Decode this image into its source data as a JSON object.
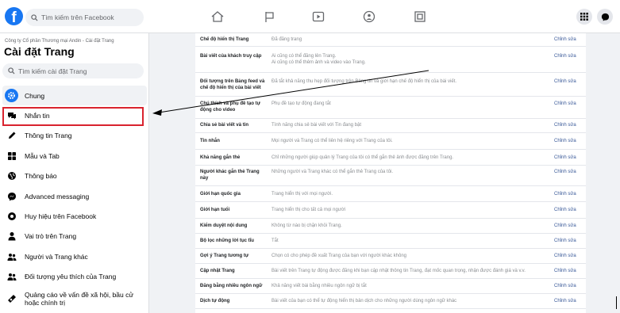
{
  "topbar": {
    "logo": "f",
    "search_placeholder": "Tìm kiếm trên Facebook",
    "nav_icons": [
      "home-icon",
      "flag-icon",
      "video-icon",
      "groups-icon",
      "gaming-icon"
    ],
    "right_icons": [
      "menu-grid-icon",
      "messenger-icon"
    ]
  },
  "sidebar": {
    "company": "Công ty Cổ phần Thương mại Andin - Cài đặt Trang",
    "title": "Cài đặt Trang",
    "search_placeholder": "Tìm kiếm cài đặt Trang",
    "items": [
      {
        "label": "Chung",
        "icon": "gear-icon"
      },
      {
        "label": "Nhắn tin",
        "icon": "chat-bubble-icon"
      },
      {
        "label": "Thông tin Trang",
        "icon": "pencil-icon"
      },
      {
        "label": "Mẫu và Tab",
        "icon": "tabs-grid-icon"
      },
      {
        "label": "Thông báo",
        "icon": "globe-icon"
      },
      {
        "label": "Advanced messaging",
        "icon": "messenger-icon"
      },
      {
        "label": "Huy hiệu trên Facebook",
        "icon": "badge-icon"
      },
      {
        "label": "Vai trò trên Trang",
        "icon": "person-icon"
      },
      {
        "label": "Người và Trang khác",
        "icon": "people-icon"
      },
      {
        "label": "Đối tượng yêu thích của Trang",
        "icon": "people-icon"
      },
      {
        "label": "Quảng cáo về vấn đề xã hội, bầu cử hoặc chính trị",
        "icon": "ads-icon"
      }
    ]
  },
  "settings": [
    {
      "name": "Chế độ hiển thị Trang",
      "value": "Đã đăng trang",
      "edit": "Chỉnh sửa"
    },
    {
      "name": "Bài viết của khách truy cập",
      "value": "Ai cũng có thể đăng lên Trang.\nAi cũng có thể thêm ảnh và video vào Trang.",
      "edit": "Chỉnh sửa"
    },
    {
      "name": "Đối tượng trên Bảng feed và chế độ hiển thị của bài viết",
      "value": "Đã tắt khả năng thu hẹp đối tượng trên Bảng tin và giới hạn chế độ hiển thị của bài viết.",
      "edit": "Chỉnh sửa"
    },
    {
      "name": "Chú thích và phụ đề tạo tự động cho video",
      "value": "Phụ đề tạo tự động đang tắt",
      "edit": "Chỉnh sửa"
    },
    {
      "name": "Chia sẻ bài viết và tin",
      "value": "Tính năng chia sẻ bài viết với Tin đang bật",
      "edit": "Chỉnh sửa"
    },
    {
      "name": "Tin nhắn",
      "value": "Mọi người và Trang có thể liên hệ riêng với Trang của tôi.",
      "edit": "Chỉnh sửa"
    },
    {
      "name": "Khả năng gắn thẻ",
      "value": "Chỉ những người giúp quản lý Trang của tôi có thể gắn thẻ ảnh được đăng trên Trang.",
      "edit": "Chỉnh sửa"
    },
    {
      "name": "Người khác gắn thẻ Trang này",
      "value": "Những người và Trang khác có thể gắn thẻ Trang của tôi.",
      "edit": "Chỉnh sửa"
    },
    {
      "name": "Giới hạn quốc gia",
      "value": "Trang hiển thị với mọi người.",
      "edit": "Chỉnh sửa"
    },
    {
      "name": "Giới hạn tuổi",
      "value": "Trang hiển thị cho tất cả mọi người",
      "edit": "Chỉnh sửa"
    },
    {
      "name": "Kiểm duyệt nội dung",
      "value": "Không từ nào bị chặn khỏi Trang.",
      "edit": "Chỉnh sửa"
    },
    {
      "name": "Bộ lọc những lời tục tĩu",
      "value": "Tắt",
      "edit": "Chỉnh sửa"
    },
    {
      "name": "Gợi ý Trang tương tự",
      "value": "Chọn có cho phép đề xuất Trang của bạn với người khác không",
      "edit": "Chỉnh sửa"
    },
    {
      "name": "Cập nhật Trang",
      "value": "Bài viết trên Trang tự động được đăng khi bạn cập nhật thông tin Trang, đạt mốc quan trọng, nhận được đánh giá và v.v.",
      "edit": "Chỉnh sửa"
    },
    {
      "name": "Đăng bằng nhiều ngôn ngữ",
      "value": "Khả năng viết bài bằng nhiều ngôn ngữ bị tắt",
      "edit": "Chỉnh sửa"
    },
    {
      "name": "Dịch tự động",
      "value": "Bài viết của bạn có thể tự động hiển thị bản dịch cho những người dùng ngôn ngữ khác",
      "edit": "Chỉnh sửa"
    }
  ]
}
